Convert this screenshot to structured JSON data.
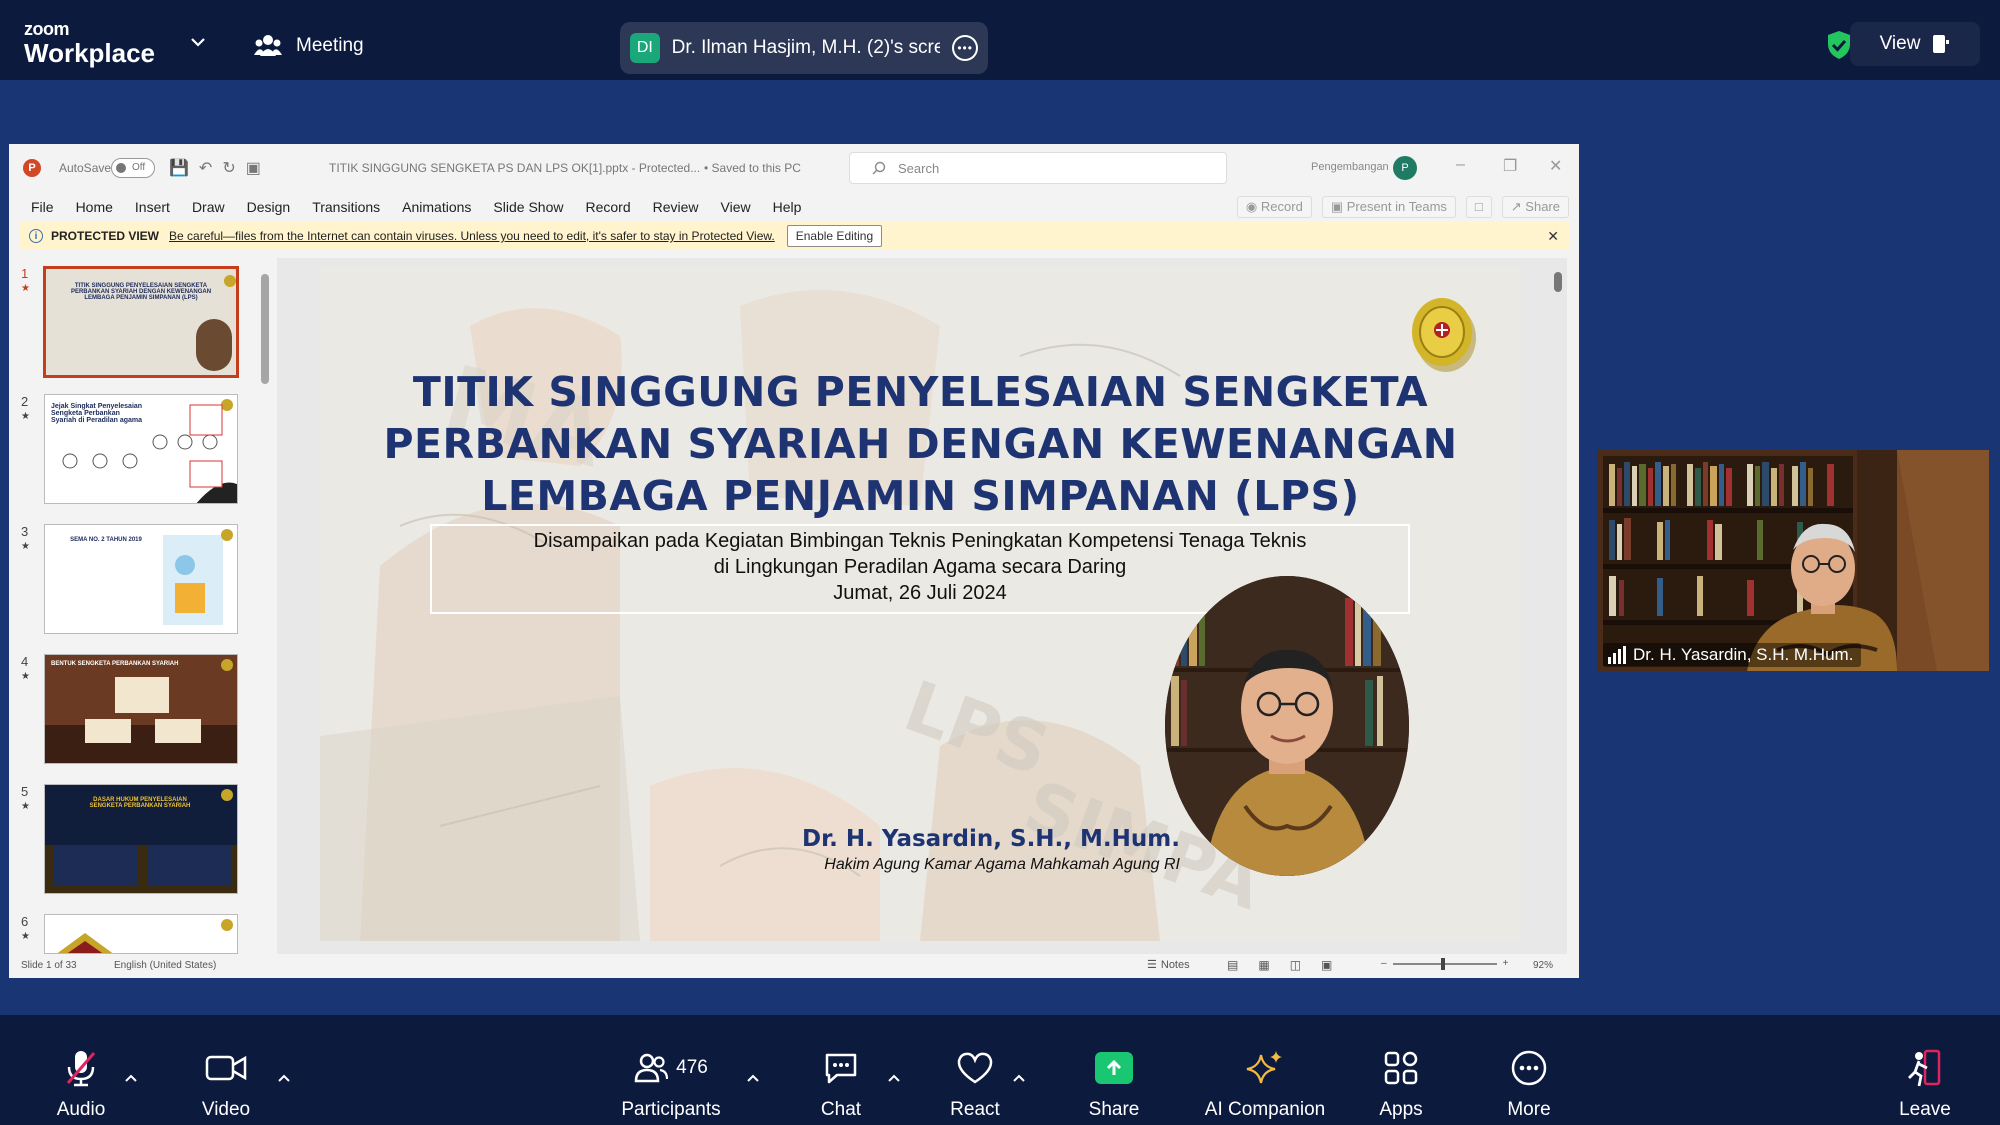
{
  "topbar": {
    "logo_line1": "zoom",
    "logo_line2": "Workplace",
    "meeting_label": "Meeting",
    "share_initials": "DI",
    "share_text": "Dr. Ilman Hasjim, M.H. (2)'s scree",
    "view_label": "View"
  },
  "ppt": {
    "autosave_label": "AutoSave",
    "autosave_state": "Off",
    "filename": "TITIK SINGGUNG SENGKETA PS DAN LPS OK[1].pptx  -  Protected...",
    "saved_status": "• Saved to this PC",
    "search_placeholder": "Search",
    "account_name": "Pengembangan",
    "account_initial": "P",
    "menu": [
      "File",
      "Home",
      "Insert",
      "Draw",
      "Design",
      "Transitions",
      "Animations",
      "Slide Show",
      "Record",
      "Review",
      "View",
      "Help"
    ],
    "ribbon_right": {
      "record": "Record",
      "present": "Present in Teams",
      "share": "Share"
    },
    "protected": {
      "label": "PROTECTED VIEW",
      "message": "Be careful—files from the Internet can contain viruses. Unless you need to edit, it's safer to stay in Protected View.",
      "button": "Enable Editing"
    },
    "thumbnails": [
      {
        "num": "1",
        "caption": "TITIK SINGGUNG PENYELESAIAN SENGKETA PERBANKAN SYARIAH DENGAN KEWENANGAN LEMBAGA PENJAMIN SIMPANAN (LPS)"
      },
      {
        "num": "2",
        "caption": "Jejak Singkat Penyelesaian Sengketa Perbankan Syariah di Peradilan agama"
      },
      {
        "num": "3",
        "caption": "SEMA NO. 2 TAHUN 2019"
      },
      {
        "num": "4",
        "caption": "BENTUK SENGKETA PERBANKAN SYARIAH"
      },
      {
        "num": "5",
        "caption": "DASAR HUKUM PENYELESAIAN SENGKETA PERBANKAN SYARIAH"
      },
      {
        "num": "6",
        "caption": ""
      }
    ],
    "slide": {
      "title_lines": [
        "TITIK SINGGUNG PENYELESAIAN SENGKETA",
        "PERBANKAN SYARIAH DENGAN KEWENANGAN",
        "LEMBAGA PENJAMIN SIMPANAN (LPS)"
      ],
      "sub_lines": [
        "Disampaikan pada Kegiatan Bimbingan Teknis Peningkatan Kompetensi Tenaga Teknis",
        "di Lingkungan Peradilan Agama secara Daring",
        "Jumat, 26 Juli 2024"
      ],
      "speaker_name": "Dr. H. Yasardin, S.H., M.Hum.",
      "speaker_role": "Hakim Agung Kamar Agama Mahkamah Agung RI"
    },
    "status": {
      "slide_info": "Slide 1 of 33",
      "language": "English (United States)",
      "notes": "Notes",
      "zoom": "92%"
    }
  },
  "video_tile": {
    "name": "Dr. H. Yasardin, S.H. M.Hum."
  },
  "toolbar": {
    "audio": "Audio",
    "video": "Video",
    "participants": "Participants",
    "participant_count": "476",
    "chat": "Chat",
    "react": "React",
    "share": "Share",
    "ai_companion": "AI Companion",
    "apps": "Apps",
    "more": "More",
    "leave": "Leave"
  },
  "colors": {
    "zoom_bg": "#0c1a3e",
    "meeting_bg": "#1a3573",
    "share_green": "#19c773",
    "slide_title_blue": "#1d3372",
    "ppt_accent": "#c43e1c",
    "audio_muted": "#e0245e"
  }
}
